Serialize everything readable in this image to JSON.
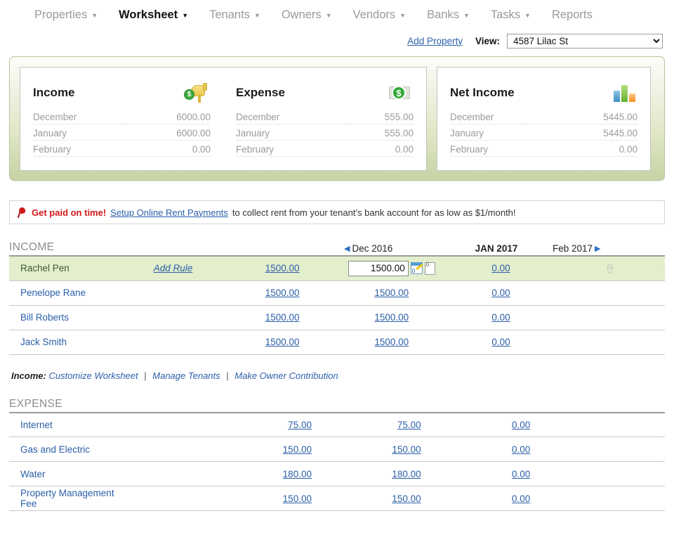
{
  "nav": {
    "items": [
      {
        "label": "Properties",
        "has_caret": true,
        "active": false
      },
      {
        "label": "Worksheet",
        "has_caret": true,
        "active": true
      },
      {
        "label": "Tenants",
        "has_caret": true,
        "active": false
      },
      {
        "label": "Owners",
        "has_caret": true,
        "active": false
      },
      {
        "label": "Vendors",
        "has_caret": true,
        "active": false
      },
      {
        "label": "Banks",
        "has_caret": true,
        "active": false
      },
      {
        "label": "Tasks",
        "has_caret": true,
        "active": false
      },
      {
        "label": "Reports",
        "has_caret": false,
        "active": false
      }
    ],
    "caret_glyph": "▼"
  },
  "subbar": {
    "add_property_label": "Add Property",
    "view_label": "View:",
    "view_selected": "4587 Lilac St",
    "view_options": [
      "4587 Lilac St"
    ]
  },
  "summary": {
    "cards": [
      {
        "title": "Income",
        "icon": "mailbox-money-icon",
        "rows": [
          {
            "month": "December",
            "amount": "6000.00"
          },
          {
            "month": "January",
            "amount": "6000.00"
          },
          {
            "month": "February",
            "amount": "0.00"
          }
        ]
      },
      {
        "title": "Expense",
        "icon": "dollar-bill-icon",
        "rows": [
          {
            "month": "December",
            "amount": "555.00"
          },
          {
            "month": "January",
            "amount": "555.00"
          },
          {
            "month": "February",
            "amount": "0.00"
          }
        ]
      },
      {
        "title": "Net Income",
        "icon": "bar-chart-icon",
        "rows": [
          {
            "month": "December",
            "amount": "5445.00"
          },
          {
            "month": "January",
            "amount": "5445.00"
          },
          {
            "month": "February",
            "amount": "0.00"
          }
        ]
      }
    ]
  },
  "promo": {
    "icon": "pushpin-icon",
    "bold_text": "Get paid on time!",
    "link_text": "Setup Online Rent Payments",
    "tail_text": "to collect rent from your tenant’s bank account for as low as $1/month!"
  },
  "worksheet": {
    "columns": {
      "prev_arrow": "◀",
      "next_arrow": "▶",
      "prev_month": "Dec 2016",
      "current_month": "JAN 2017",
      "next_month": "Feb 2017"
    },
    "income": {
      "section_title": "INCOME",
      "rows": [
        {
          "name": "Rachel Pen",
          "selected": true,
          "add_rule_label": "Add Rule",
          "dec": "1500.00",
          "jan_input_value": "1500.00",
          "note_count": "0",
          "feb": "0.00",
          "delete_glyph": "×"
        },
        {
          "name": "Penelope Rane",
          "selected": false,
          "dec": "1500.00",
          "jan": "1500.00",
          "feb": "0.00"
        },
        {
          "name": "Bill Roberts",
          "selected": false,
          "dec": "1500.00",
          "jan": "1500.00",
          "feb": "0.00"
        },
        {
          "name": "Jack Smith",
          "selected": false,
          "dec": "1500.00",
          "jan": "1500.00",
          "feb": "0.00"
        }
      ],
      "footer": {
        "label": "Income:",
        "links": [
          "Customize Worksheet",
          "Manage Tenants",
          "Make Owner Contribution"
        ],
        "separator": "|"
      }
    },
    "expense": {
      "section_title": "EXPENSE",
      "rows": [
        {
          "name": "Internet",
          "dec": "75.00",
          "jan": "75.00",
          "feb": "0.00"
        },
        {
          "name": "Gas and Electric",
          "dec": "150.00",
          "jan": "150.00",
          "feb": "0.00"
        },
        {
          "name": "Water",
          "dec": "180.00",
          "jan": "180.00",
          "feb": "0.00"
        },
        {
          "name": "Property Management Fee",
          "dec": "150.00",
          "jan": "150.00",
          "feb": "0.00"
        }
      ]
    }
  },
  "colors": {
    "link": "#2b5fa8",
    "selected_row": "#e3eecc",
    "panel_green": "#c7d3a4",
    "promo_red": "#d21919"
  }
}
